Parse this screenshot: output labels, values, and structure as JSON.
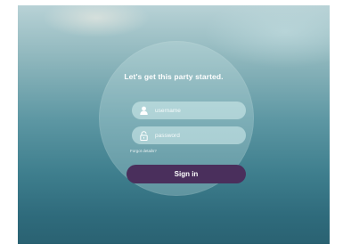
{
  "login": {
    "headline": "Let's get this party started.",
    "username_placeholder": "username",
    "password_placeholder": "password",
    "forgot_link": "Forgot details?",
    "signin_label": "Sign in"
  },
  "icons": {
    "username": "user-icon",
    "password": "lock-icon"
  },
  "colors": {
    "button": "#4a2f5c",
    "field": "#d7f0f0",
    "text": "#ffffff"
  }
}
